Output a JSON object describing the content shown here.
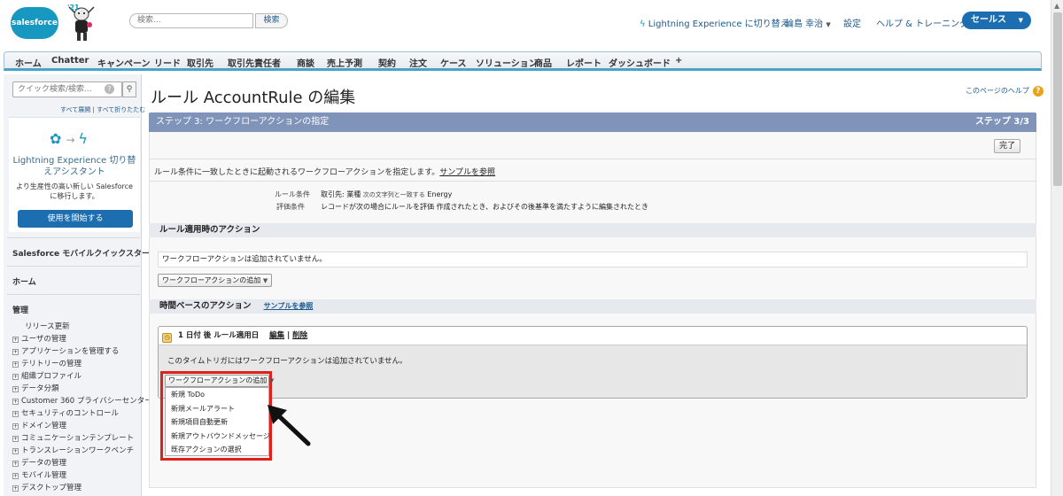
{
  "header": {
    "logo_text": "salesforce",
    "mascot_year": "'21",
    "search_placeholder": "検索...",
    "search_button": "検索",
    "switch_lightning": "Lightning Experience に切り替え",
    "user_name": "輪島 幸治",
    "settings": "設定",
    "help_training": "ヘルプ & トレーニング",
    "app_menu": "セールス"
  },
  "tabs": [
    "ホーム",
    "Chatter",
    "キャンペーン",
    "リード",
    "取引先",
    "取引先責任者",
    "商談",
    "売上予測",
    "契約",
    "注文",
    "ケース",
    "ソリューション",
    "商品",
    "レポート",
    "ダッシュボード",
    "+"
  ],
  "sidebar": {
    "quick_search_placeholder": "クイック検索/検索...",
    "quick_search_help": "?",
    "expand_all": "すべて展開",
    "link_sep": "|",
    "collapse_all": "すべて折りたたむ",
    "promo_title": "Lightning Experience 切り替えアシスタント",
    "promo_desc": "より生産性の高い新しい Salesforce に移行します。",
    "promo_button": "使用を開始する",
    "mobile_quickstart": "Salesforce モバイルクイックスタート",
    "home": "ホーム",
    "admin": "管理",
    "release_update": "リリース更新",
    "items": [
      "ユーザの管理",
      "アプリケーションを管理する",
      "テリトリーの管理",
      "組織プロファイル",
      "データ分類",
      "Customer 360 プライバシーセンター",
      "セキュリティのコントロール",
      "ドメイン管理",
      "コミュニケーションテンプレート",
      "トランスレーションワークベンチ",
      "データの管理",
      "モバイル管理",
      "デスクトップ管理"
    ]
  },
  "main": {
    "page_title": "ルール AccountRule の編集",
    "help_link": "このページのヘルプ",
    "step_title": "ステップ 3: ワークフローアクションの指定",
    "step_count": "ステップ 3/3",
    "done_button": "完了",
    "description": "ルール条件に一致したときに起動されるワークフローアクションを指定します。",
    "sample_link": "サンプルを参照",
    "rule_criteria_label": "ルール条件",
    "rule_criteria_value_main": "取引先: 業種",
    "rule_criteria_value_small": "次の文字列と一致する",
    "rule_criteria_value_end": "Energy",
    "eval_criteria_label": "評価条件",
    "eval_criteria_value": "レコードが次の場合にルールを評価 作成されたとき、およびその後基準を満たすように編集されたとき",
    "immediate_section": "ルール適用時のアクション",
    "immediate_note": "ワークフローアクションは追加されていません。",
    "add_action_select": "ワークフローアクションの追加",
    "time_section": "時間ベースのアクション",
    "time_sample_link": "サンプルを参照",
    "trigger_title": "1 日付 後 ルール適用日",
    "trigger_edit": "編集",
    "trigger_sep": "|",
    "trigger_delete": "削除",
    "trigger_note": "このタイムトリガにはワークフローアクションは追加されていません。",
    "dropdown_label": "ワークフローアクションの追加",
    "dropdown_items": [
      "新規 ToDo",
      "新規メールアラート",
      "新規項目自動更新",
      "新規アウトバウンドメッセージ",
      "既存アクションの選択"
    ]
  },
  "colors": {
    "brand_blue": "#1798c1",
    "button_blue": "#1c6eb0",
    "step_bar": "#7f94b8",
    "highlight_red": "#e0201a"
  },
  "icons": [
    "search-icon",
    "help-icon",
    "flower-icon",
    "arrow-right-icon",
    "lightning-icon",
    "trigger-clock-icon",
    "chevron-down-icon",
    "pointer-arrow-icon"
  ]
}
